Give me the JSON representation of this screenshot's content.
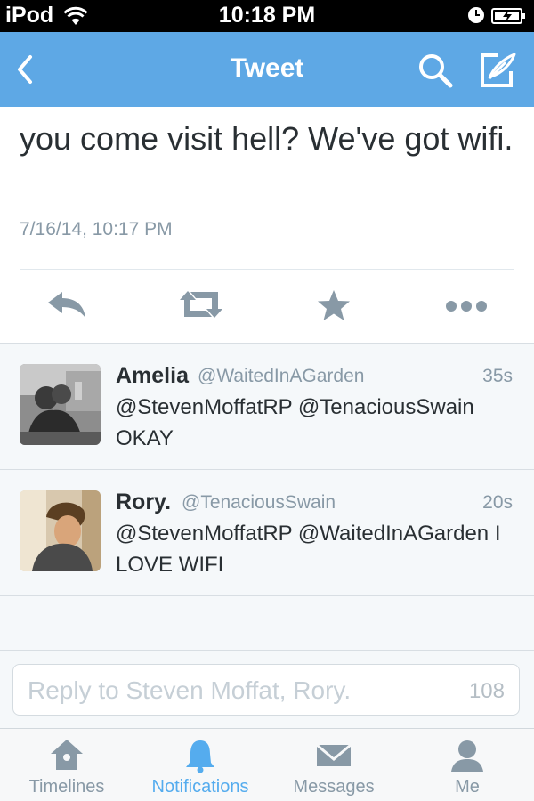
{
  "status_bar": {
    "carrier": "iPod",
    "time": "10:18 PM"
  },
  "nav": {
    "title": "Tweet"
  },
  "tweet": {
    "text": "you come visit hell? We've got wifi.",
    "timestamp": "7/16/14, 10:17 PM"
  },
  "replies": [
    {
      "name": "Amelia",
      "handle": "@WaitedInAGarden",
      "time_ago": "35s",
      "text": "@StevenMoffatRP @TenaciousSwain OKAY"
    },
    {
      "name": "Rory.",
      "handle": "@TenaciousSwain",
      "time_ago": "20s",
      "text": "@StevenMoffatRP @WaitedInAGarden I LOVE WIFI"
    }
  ],
  "compose": {
    "placeholder": "Reply to Steven Moffat, Rory.",
    "char_count": "108"
  },
  "tabbar": {
    "tabs": [
      {
        "label": "Timelines",
        "icon": "home-icon"
      },
      {
        "label": "Notifications",
        "icon": "bell-icon",
        "active": true
      },
      {
        "label": "Messages",
        "icon": "envelope-icon"
      },
      {
        "label": "Me",
        "icon": "person-icon"
      }
    ]
  },
  "colors": {
    "nav_blue": "#5ea8e5",
    "accent": "#55acee",
    "muted": "#8899a6",
    "text": "#292f33"
  }
}
